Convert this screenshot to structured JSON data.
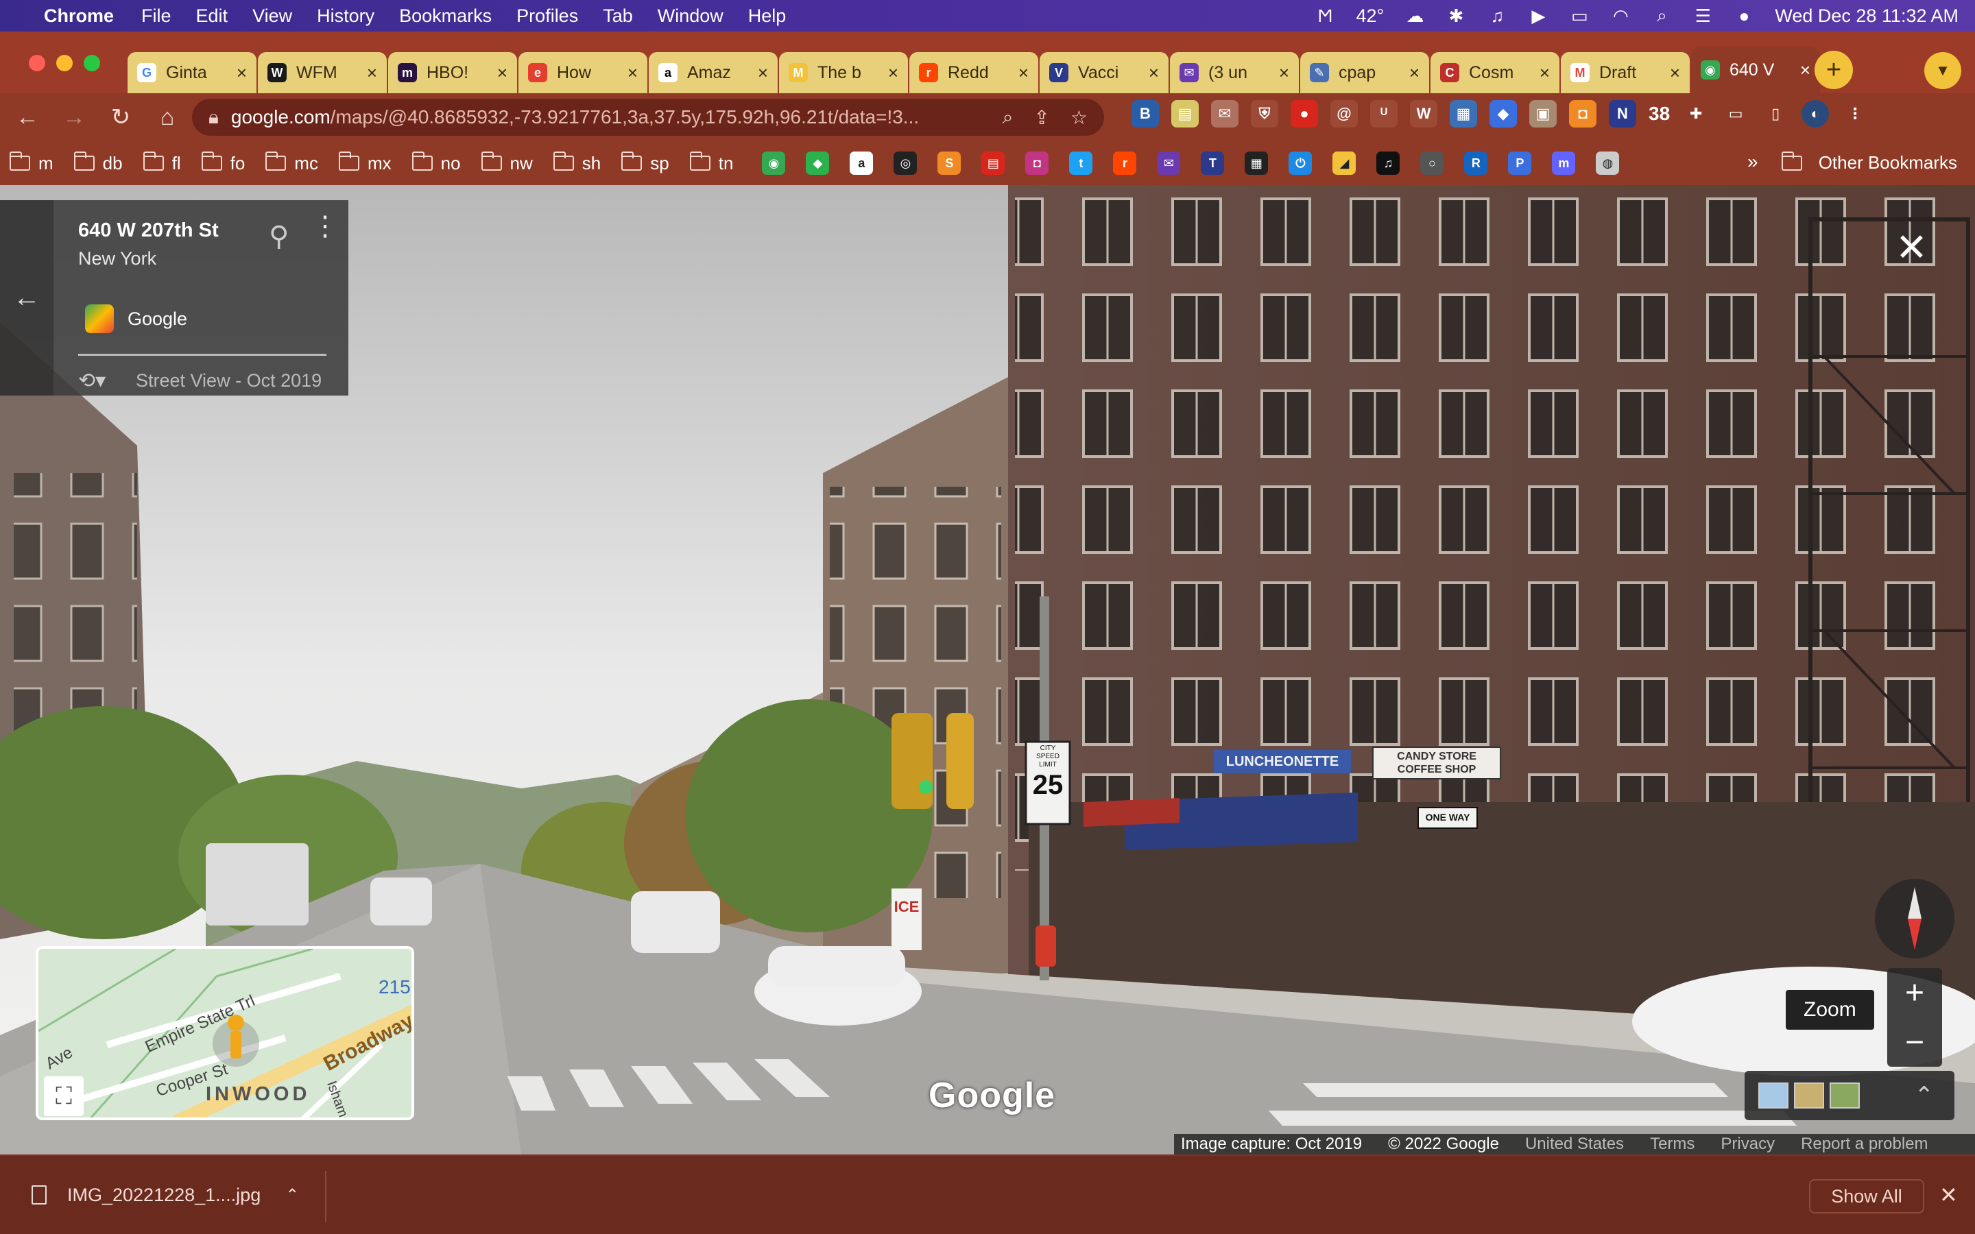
{
  "menubar": {
    "app_name": "Chrome",
    "menus": [
      "File",
      "Edit",
      "View",
      "History",
      "Bookmarks",
      "Profiles",
      "Tab",
      "Window",
      "Help"
    ],
    "weather": "42°",
    "datetime": "Wed Dec 28  11:32 AM"
  },
  "tabs": [
    {
      "title": "Ginta",
      "fav": "G",
      "color": "#ffffff",
      "text": "#4285f4"
    },
    {
      "title": "WFM",
      "fav": "W",
      "color": "#1a1a1a",
      "text": "#ffffff"
    },
    {
      "title": "HBO!",
      "fav": "m",
      "color": "#2a1240",
      "text": "#ffffff"
    },
    {
      "title": "How",
      "fav": "e",
      "color": "#e53e2e",
      "text": "#ffffff"
    },
    {
      "title": "Amaz",
      "fav": "a",
      "color": "#ffffff",
      "text": "#000000"
    },
    {
      "title": "The b",
      "fav": "M",
      "color": "#f2c23a",
      "text": "#ffffff"
    },
    {
      "title": "Redd",
      "fav": "r",
      "color": "#ff4500",
      "text": "#ffffff"
    },
    {
      "title": "Vacci",
      "fav": "V",
      "color": "#2b3a8c",
      "text": "#ffffff"
    },
    {
      "title": "(3 un",
      "fav": "✉",
      "color": "#6a3ab0",
      "text": "#ffffff"
    },
    {
      "title": "cpap",
      "fav": "✎",
      "color": "#4a6fb0",
      "text": "#ffffff"
    },
    {
      "title": "Cosm",
      "fav": "C",
      "color": "#c0302a",
      "text": "#ffffff"
    },
    {
      "title": "Draft",
      "fav": "M",
      "color": "#ffffff",
      "text": "#ea4335"
    },
    {
      "title": "640 V",
      "fav": "◉",
      "color": "#34a853",
      "text": "#ffffff",
      "active": true
    }
  ],
  "toolbar": {
    "url_host": "google.com",
    "url_rest": "/maps/@40.8685932,-73.9217761,3a,37.5y,175.92h,96.21t/data=!3...",
    "ext_count": "38"
  },
  "bookmarks": {
    "folders": [
      "m",
      "db",
      "fl",
      "fo",
      "mc",
      "mx",
      "no",
      "nw",
      "sh",
      "sp",
      "tn"
    ],
    "icons": [
      {
        "name": "maps",
        "color": "#34a853",
        "g": "◉"
      },
      {
        "name": "feedly",
        "color": "#2bb24c",
        "g": "◆"
      },
      {
        "name": "amazon",
        "color": "#ffffff",
        "g": "a"
      },
      {
        "name": "target",
        "color": "#222222",
        "g": "◎"
      },
      {
        "name": "s",
        "color": "#f08a24",
        "g": "S"
      },
      {
        "name": "red",
        "color": "#d9261c",
        "g": "▤"
      },
      {
        "name": "instagram",
        "color": "#c13584",
        "g": "◘"
      },
      {
        "name": "twitter",
        "color": "#1da1f2",
        "g": "t"
      },
      {
        "name": "reddit",
        "color": "#ff4500",
        "g": "r"
      },
      {
        "name": "mail",
        "color": "#6a3ab0",
        "g": "✉"
      },
      {
        "name": "t",
        "color": "#2b3a8c",
        "g": "T"
      },
      {
        "name": "film",
        "color": "#222222",
        "g": "▦"
      },
      {
        "name": "power",
        "color": "#1e88e5",
        "g": "⏻"
      },
      {
        "name": "car",
        "color": "#f2c23a",
        "g": "◢"
      },
      {
        "name": "headphones",
        "color": "#111111",
        "g": "♫"
      },
      {
        "name": "ring",
        "color": "#555555",
        "g": "○"
      },
      {
        "name": "r",
        "color": "#1565c0",
        "g": "R"
      },
      {
        "name": "p",
        "color": "#3b6fe0",
        "g": "P"
      },
      {
        "name": "mastodon",
        "color": "#6364ff",
        "g": "m"
      },
      {
        "name": "globe",
        "color": "#cccccc",
        "g": "◍"
      }
    ],
    "chevron": "»",
    "other": "Other Bookmarks"
  },
  "streetview": {
    "address": "640 W 207th St",
    "city": "New York",
    "contributor": "Google",
    "date": "Street View - Oct 2019",
    "minimap": {
      "neighborhood": "INWOOD",
      "labels": [
        "Empire State Trl",
        "Cooper St",
        "Broadway",
        "Ave",
        "Isham"
      ],
      "route": "215"
    },
    "zoom_tip": "Zoom",
    "watermark": "Google",
    "footer": {
      "capture": "Image capture: Oct 2019",
      "copyright": "© 2022 Google",
      "country": "United States",
      "terms": "Terms",
      "privacy": "Privacy",
      "report": "Report a problem"
    },
    "signs": {
      "speed": [
        "CITY",
        "SPEED",
        "LIMIT",
        "25"
      ],
      "luncheonette": "LUNCHEONETTE",
      "candy": [
        "CANDY STORE",
        "COFFEE SHOP"
      ],
      "oneway": "ONE WAY",
      "ice": "ICE"
    }
  },
  "downloads": {
    "file": "IMG_20221228_1....jpg",
    "show_all": "Show All"
  }
}
